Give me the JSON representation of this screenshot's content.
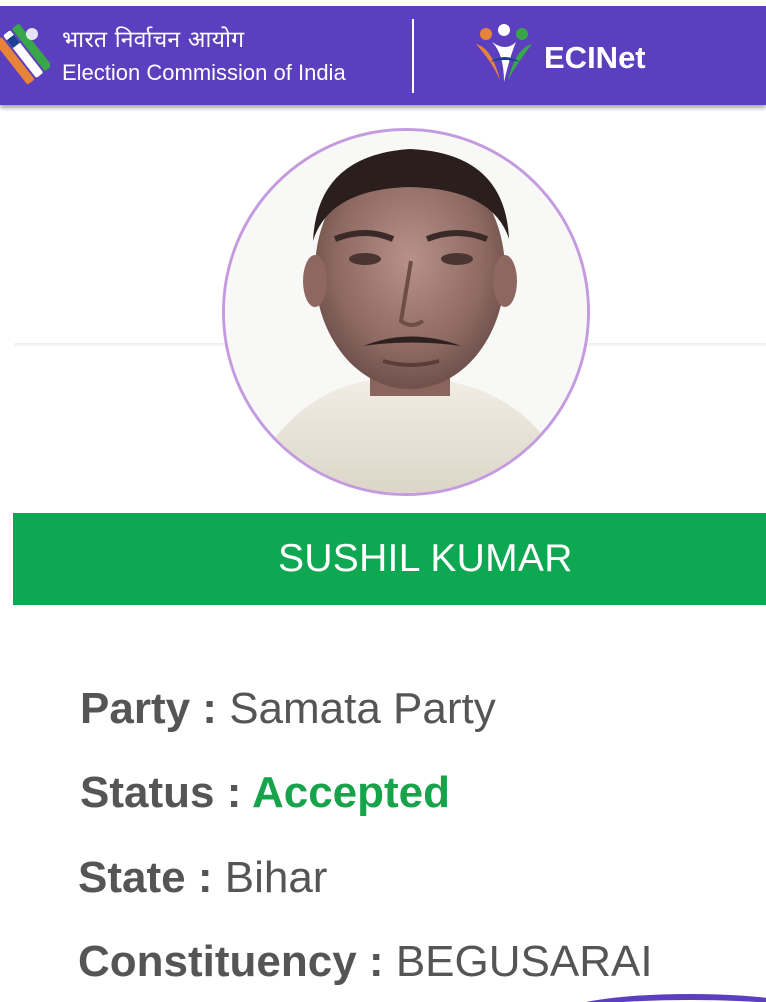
{
  "header": {
    "org_hindi": "भारत निर्वाचन आयोग",
    "org_english": "Election Commission of India",
    "app_name": "ECINet",
    "logo_icon": "eci-voting-ballot-icon",
    "app_logo_icon": "ecinet-people-icon",
    "background_color": "#5b3fbf"
  },
  "candidate": {
    "name": "SUSHIL KUMAR",
    "photo_icon": "candidate-photo",
    "banner_color": "#0ea852",
    "ring_color": "#c59be0"
  },
  "details": {
    "party_label": "Party",
    "party_value": "Samata Party",
    "status_label": "Status",
    "status_value": "Accepted",
    "status_color": "#16a34a",
    "state_label": "State",
    "state_value": "Bihar",
    "constituency_label": "Constituency",
    "constituency_value": "BEGUSARAI",
    "separator": ":"
  }
}
